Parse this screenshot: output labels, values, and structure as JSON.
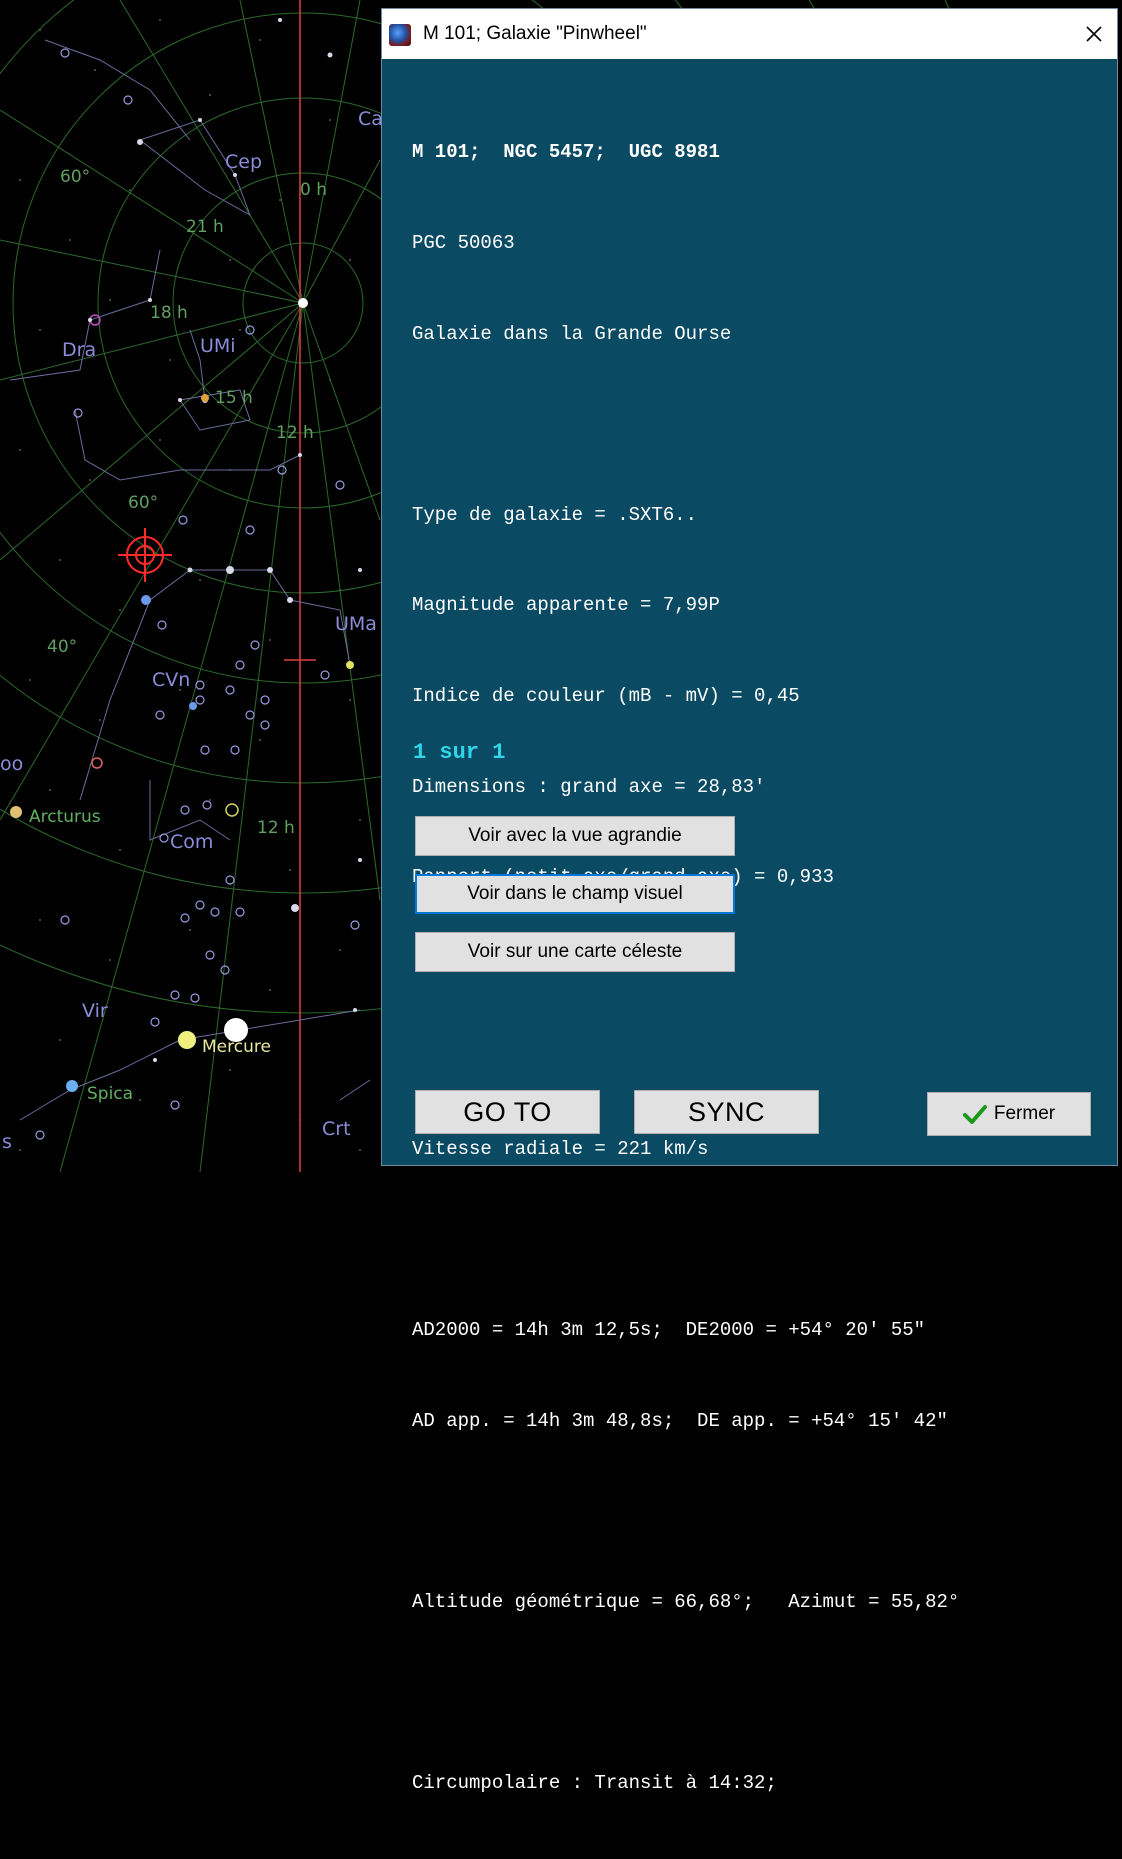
{
  "window": {
    "title": "M 101; Galaxie \"Pinwheel\""
  },
  "info_lines": {
    "l1": "M 101;  NGC 5457;  UGC 8981",
    "l2": "PGC 50063",
    "l3": "Galaxie dans la Grande Ourse",
    "l5": "Type de galaxie = .SXT6..",
    "l6": "Magnitude apparente = 7,99P",
    "l7": "Indice de couleur (mB - mV) = 0,45",
    "l8": "Dimensions : grand axe = 28,83'",
    "l9": "Rapport (petit axe/grand axe) = 0,933",
    "l12": "Vitesse radiale = 221 km/s",
    "l14": "AD2000 = 14h 3m 12,5s;  DE2000 = +54° 20' 55\"",
    "l15": "AD app. = 14h 3m 48,8s;  DE app. = +54° 15' 42\"",
    "l17": "Altitude géométrique = 66,68°;   Azimut = 55,82°",
    "l19": "Circumpolaire : Transit à 14:32;"
  },
  "counter": "1 sur 1",
  "buttons": {
    "zoom_view": "Voir avec la vue agrandie",
    "field_view": "Voir dans le champ visuel",
    "sky_map": "Voir sur une carte céleste",
    "goto": "GO TO",
    "sync": "SYNC",
    "close": "Fermer"
  },
  "sky_labels": {
    "cep": "Cep",
    "dra": "Dra",
    "umi": "UMi",
    "uma": "UMa",
    "cvn": "CVn",
    "com": "Com",
    "vir": "Vir",
    "crt": "Crt",
    "ca": "Ca",
    "boo": "oo",
    "s": "s",
    "arcturus": "Arcturus",
    "spica": "Spica",
    "mercure": "Mercure",
    "h0": "0 h",
    "h21": "21 h",
    "h18": "18 h",
    "h15": "15 h",
    "h12a": "12 h",
    "h12b": "12 h",
    "d60a": "60°",
    "d60b": "60°",
    "d40": "40°"
  },
  "colors": {
    "dialog_bg": "#0b4a63",
    "counter": "#2ed6ea",
    "meridian": "#e04040",
    "constellation_label": "#8c8cd8",
    "grid": "#2c6a2c"
  }
}
